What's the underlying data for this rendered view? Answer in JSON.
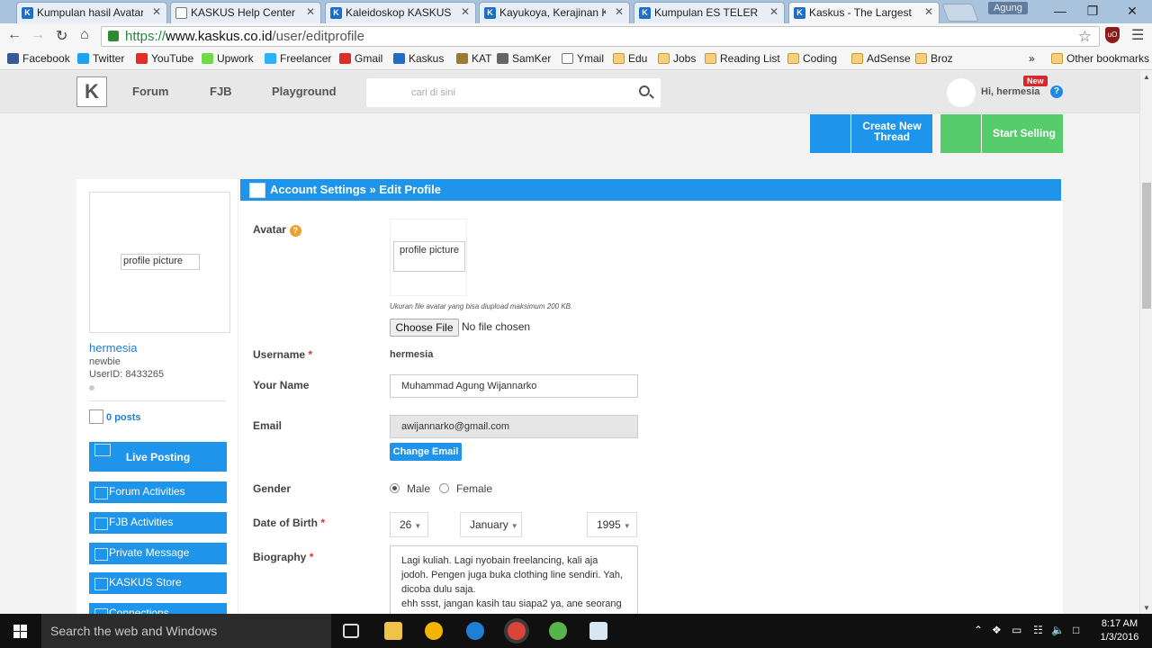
{
  "browser": {
    "tabs": [
      {
        "title": "Kumpulan hasil Avatar | K",
        "icon": "kaskus-icon"
      },
      {
        "title": "KASKUS Help Center - M",
        "icon": "document-icon"
      },
      {
        "title": "Kaleidoskop KASKUS Jua",
        "icon": "kaskus-icon"
      },
      {
        "title": "Kayukoya, Kerajinan Kay",
        "icon": "kaskus-icon"
      },
      {
        "title": "Kumpulan ES TELER alias",
        "icon": "kaskus-icon"
      },
      {
        "title": "Kaskus - The Largest Ind",
        "icon": "kaskus-icon",
        "active": true
      }
    ],
    "profile_name": "Agung",
    "url": {
      "proto": "https://",
      "host": "www.kaskus.co.id",
      "path": "/user/editprofile"
    },
    "bookmarks": [
      {
        "label": "Facebook",
        "icon": "facebook-icon",
        "color": "#3b5998"
      },
      {
        "label": "Twitter",
        "icon": "twitter-icon",
        "color": "#1da1f2"
      },
      {
        "label": "YouTube",
        "icon": "youtube-icon",
        "color": "#e52d27"
      },
      {
        "label": "Upwork",
        "icon": "upwork-icon",
        "color": "#6fda44"
      },
      {
        "label": "Freelancer",
        "icon": "freelancer-icon",
        "color": "#29b2fe"
      },
      {
        "label": "Gmail",
        "icon": "gmail-icon",
        "color": "#d93025"
      },
      {
        "label": "Kaskus",
        "icon": "kaskus-icon",
        "color": "#1e6ec8"
      },
      {
        "label": "KAT",
        "icon": "kat-icon",
        "color": "#9a7b2f"
      },
      {
        "label": "SamKer",
        "icon": "samker-icon",
        "color": "#666666"
      },
      {
        "label": "Ymail",
        "icon": "document-icon",
        "color": "#ffffff"
      },
      {
        "label": "Edu",
        "icon": "folder-icon",
        "color": "#f6d07a"
      },
      {
        "label": "Jobs",
        "icon": "folder-icon",
        "color": "#f6d07a"
      },
      {
        "label": "Reading List",
        "icon": "folder-icon",
        "color": "#f6d07a"
      },
      {
        "label": "Coding",
        "icon": "folder-icon",
        "color": "#f6d07a"
      },
      {
        "label": "AdSense",
        "icon": "folder-icon",
        "color": "#f6d07a"
      },
      {
        "label": "Broz",
        "icon": "folder-icon",
        "color": "#f6d07a"
      }
    ],
    "more_bookmarks": "»",
    "other_bookmarks": "Other bookmarks"
  },
  "site": {
    "logo_alt": "K",
    "nav": [
      "Forum",
      "FJB",
      "Playground"
    ],
    "search_placeholder": "cari di sini",
    "greeting": "Hi, hermesia",
    "new_badge": "New",
    "create_thread": "Create New Thread",
    "start_selling": "Start Selling",
    "accent": "#1e95ea",
    "sell_color": "#56cc6c"
  },
  "sidebar": {
    "profile_alt": "profile picture",
    "username": "hermesia",
    "rank": "newbie",
    "user_id": "UserID: 8433265",
    "posts_count": "0",
    "posts_label": "posts",
    "live_posting": "Live Posting",
    "menu": [
      "Forum Activities",
      "FJB Activities",
      "Private Message",
      "KASKUS Store",
      "Connections"
    ]
  },
  "form": {
    "header": "Account Settings » Edit Profile",
    "avatar_label": "Avatar",
    "avatar_alt": "profile picture",
    "avatar_note": "Ukuran file avatar yang bisa diupload maksimum 200 KB.",
    "choose_file": "Choose File",
    "no_file": "No file chosen",
    "username_label": "Username",
    "username_value": "hermesia",
    "name_label": "Your Name",
    "name_value": "Muhammad Agung Wijannarko",
    "email_label": "Email",
    "email_value": "awijannarko@gmail.com",
    "change_email": "Change Email",
    "gender_label": "Gender",
    "gender_male": "Male",
    "gender_female": "Female",
    "gender_selected": "Male",
    "dob_label": "Date of Birth",
    "dob_day": "26",
    "dob_month": "January",
    "dob_year": "1995",
    "bio_label": "Biography",
    "bio_value": "Lagi kuliah. Lagi nyobain freelancing, kali aja jodoh. Pengen juga buka clothing line sendiri. Yah, dicoba dulu saja.\nehh ssst, jangan kasih tau siapa2 ya, ane seorang"
  },
  "taskbar": {
    "search_placeholder": "Search the web and Windows",
    "time": "8:17 AM",
    "date": "1/3/2016"
  }
}
